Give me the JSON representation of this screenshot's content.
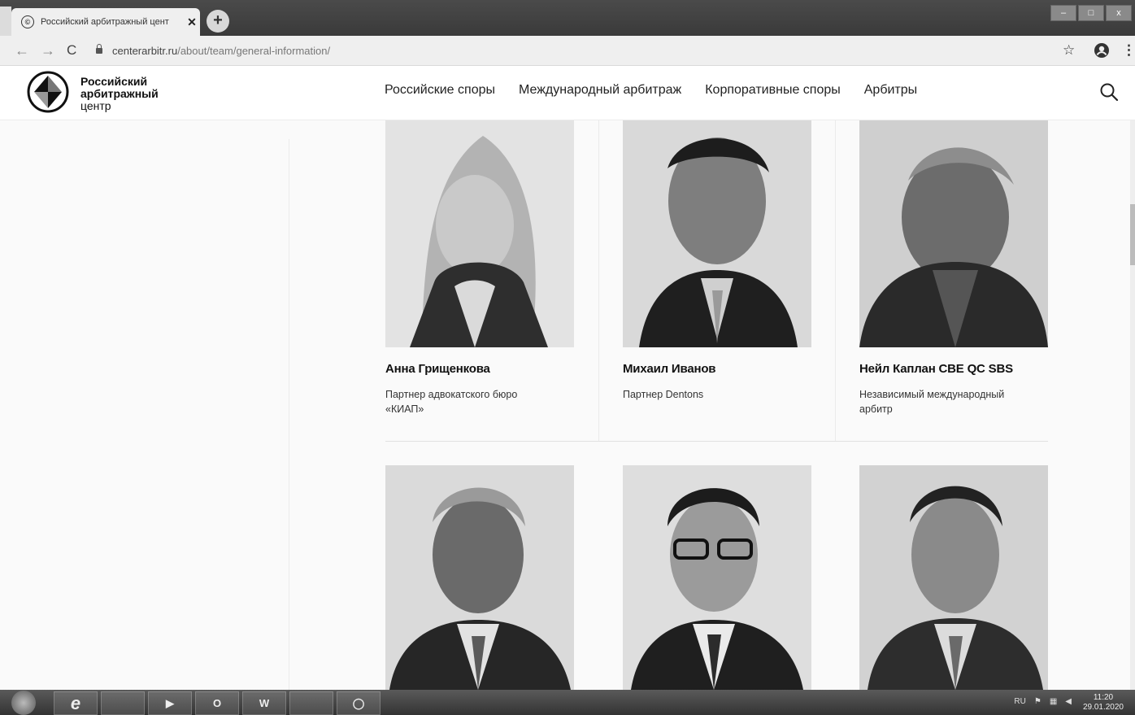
{
  "browser": {
    "tab_title": "Российский арбитражный цент",
    "tab_close": "✕",
    "new_tab": "+",
    "window_controls": [
      "–",
      "□",
      "x"
    ],
    "url_domain": "centerarbitr.ru",
    "url_path": "/about/team/general-information/"
  },
  "site": {
    "logo_line1": "Российский",
    "logo_line2": "арбитражный",
    "logo_line3": "центр",
    "nav": [
      "Российские споры",
      "Международный арбитраж",
      "Корпоративные споры",
      "Арбитры"
    ]
  },
  "team": [
    {
      "name": "Анна Грищенкова",
      "role_line1": "Партнер адвокатского бюро",
      "role_line2": "«КИАП»"
    },
    {
      "name": "Михаил Иванов",
      "role_line1": "Партнер Dentons",
      "role_line2": ""
    },
    {
      "name": "Нейл Каплан CBE QC SBS",
      "role_line1": "Независимый международный",
      "role_line2": "арбитр"
    },
    {
      "name": "",
      "role_line1": "",
      "role_line2": ""
    },
    {
      "name": "",
      "role_line1": "",
      "role_line2": ""
    },
    {
      "name": "",
      "role_line1": "",
      "role_line2": ""
    }
  ],
  "taskbar": {
    "apps": [
      "e",
      "",
      "▶",
      "O",
      "W",
      "",
      "◯"
    ],
    "tray_lang": "RU",
    "time": "11:20",
    "date": "29.01.2020"
  }
}
